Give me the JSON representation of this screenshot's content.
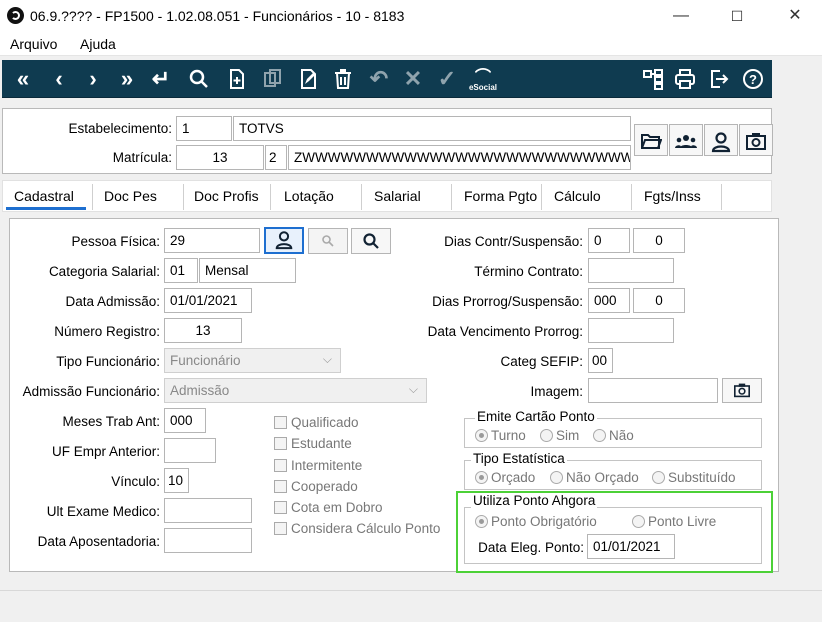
{
  "window": {
    "title": "06.9.???? - FP1500 - 1.02.08.051 - Funcionários - 10 - 8183",
    "minimize": "—",
    "maximize": "☐",
    "close": "✕"
  },
  "menu": {
    "arquivo": "Arquivo",
    "ajuda": "Ajuda"
  },
  "toolbar": {
    "esocial": "eSocial"
  },
  "header": {
    "estabelecimento_label": "Estabelecimento:",
    "estabelecimento_code": "1",
    "estabelecimento_name": "TOTVS",
    "matricula_label": "Matrícula:",
    "matricula_value": "13",
    "matricula_digit": "2",
    "matricula_name": "ZWWWWWWWWWWWWWWWWWWWWWWWWWWWWWWWWWWW"
  },
  "tabs": [
    "Cadastral",
    "Doc Pes",
    "Doc Profis",
    "Lotação",
    "Salarial",
    "Forma Pgto",
    "Cálculo",
    "Fgts/Inss"
  ],
  "form": {
    "pessoa_fisica_label": "Pessoa Física:",
    "pessoa_fisica": "29",
    "categoria_label": "Categoria Salarial:",
    "categoria_code": "01",
    "categoria_name": "Mensal",
    "data_admissao_label": "Data Admissão:",
    "data_admissao": "01/01/2021",
    "numero_registro_label": "Número Registro:",
    "numero_registro": "13",
    "tipo_funcionario_label": "Tipo Funcionário:",
    "tipo_funcionario": "Funcionário",
    "admissao_funcionario_label": "Admissão Funcionário:",
    "admissao_funcionario": "Admissão",
    "meses_trab_label": "Meses Trab Ant:",
    "meses_trab": "000",
    "uf_label": "UF Empr Anterior:",
    "uf": "",
    "vinculo_label": "Vínculo:",
    "vinculo": "10",
    "ult_exame_label": "Ult Exame Medico:",
    "ult_exame": "",
    "data_aposentadoria_label": "Data Aposentadoria:",
    "data_aposentadoria": "",
    "checks": [
      "Qualificado",
      "Estudante",
      "Intermitente",
      "Cooperado",
      "Cota em Dobro",
      "Considera Cálculo Ponto"
    ],
    "dias_contr_label": "Dias Contr/Suspensão:",
    "dias_contr_1": "0",
    "dias_contr_2": "0",
    "termino_label": "Término Contrato:",
    "termino": "",
    "dias_prorrog_label": "Dias Prorrog/Suspensão:",
    "dias_prorrog_1": "000",
    "dias_prorrog_2": "0",
    "data_venc_label": "Data Vencimento Prorrog:",
    "data_venc": "",
    "categ_sefip_label": "Categ SEFIP:",
    "categ_sefip": "00",
    "imagem_label": "Imagem:",
    "imagem": "",
    "cartao_title": "Emite Cartão Ponto",
    "cartao_options": [
      "Turno",
      "Sim",
      "Não"
    ],
    "estatistica_title": "Tipo Estatística",
    "estatistica_options": [
      "Orçado",
      "Não Orçado",
      "Substituído"
    ],
    "ponto_title": "Utiliza Ponto Ahgora",
    "ponto_options": [
      "Ponto Obrigatório",
      "Ponto Livre"
    ],
    "data_eleg_label": "Data Eleg. Ponto:",
    "data_eleg": "01/01/2021"
  },
  "colors": {
    "toolbar_bg": "#0f3b50",
    "highlight_border": "#4cd137"
  }
}
